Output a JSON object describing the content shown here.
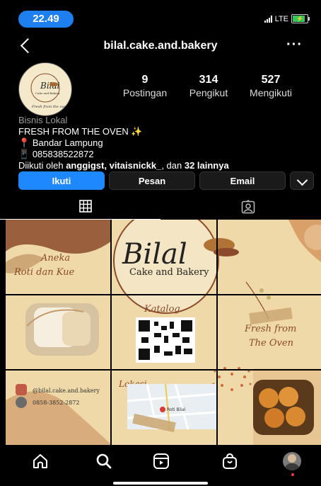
{
  "status": {
    "time": "22.49",
    "network": "LTE"
  },
  "header": {
    "username": "bilal.cake.and.bakery",
    "back_icon": "chevron-left-icon",
    "more_icon": "more-horizontal-icon",
    "more_label": "···"
  },
  "profile": {
    "avatar": {
      "name_script": "Bilal",
      "sub": "Cake and Bakery",
      "tagline": "Fresh from the oven"
    },
    "stats": [
      {
        "value": "9",
        "label": "Postingan"
      },
      {
        "value": "314",
        "label": "Pengikut"
      },
      {
        "value": "527",
        "label": "Mengikuti"
      }
    ],
    "category": "Bisnis Lokal",
    "bio_line1": "FRESH FROM THE OVEN ✨",
    "location_icon": "📍",
    "location": "Bandar Lampung",
    "phone_icon": "📱",
    "phone": "085838522872",
    "followed_by_prefix": "Diikuti oleh ",
    "followed_by_names": "anggigst, vitaisnickk_",
    "followed_by_mid": ", dan ",
    "followed_by_count": "32 lainnya"
  },
  "actions": {
    "follow": "Ikuti",
    "message": "Pesan",
    "email": "Email"
  },
  "tabs": {
    "grid_icon": "grid-icon",
    "tagged_icon": "tagged-person-icon"
  },
  "posts": {
    "title_script": "Bilal",
    "title_sub": "Cake and Bakery",
    "aneka_line1": "Aneka",
    "aneka_line2": "Roti dan Kue",
    "katalog": "Katalog",
    "fresh_line1": "Fresh from",
    "fresh_line2": "The Oven",
    "instagram": "@bilal.cake.and.bakery",
    "phone": "0858-3852-2872",
    "lokasi": "Lokasi",
    "map_pin": "Roti Bilal"
  },
  "bottom_nav": [
    "home-icon",
    "search-icon",
    "reels-icon",
    "shop-icon",
    "profile-avatar"
  ],
  "colors": {
    "accent": "#1e88ff",
    "background": "#000000",
    "post_bg": "#efd9a8",
    "brown": "#8b4a2b"
  }
}
